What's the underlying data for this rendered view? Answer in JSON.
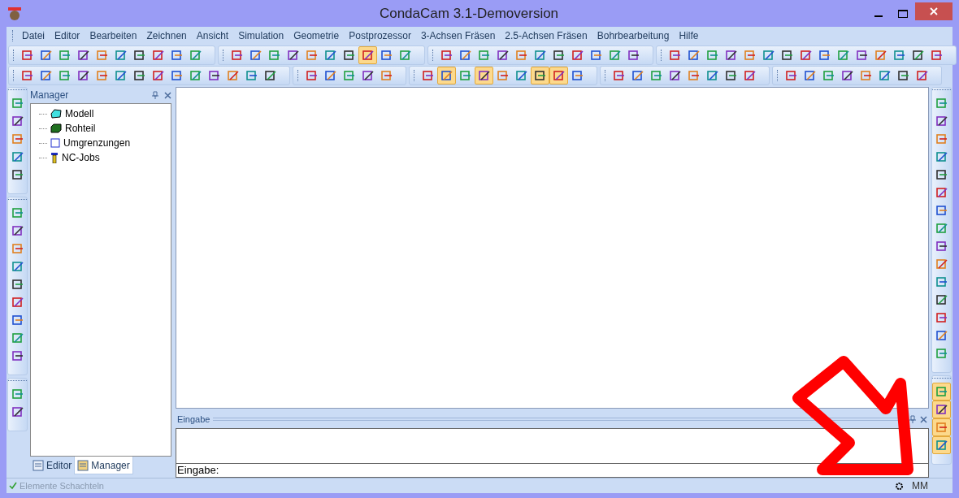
{
  "window": {
    "title": "CondaCam 3.1-Demoversion"
  },
  "menu": [
    "Datei",
    "Editor",
    "Bearbeiten",
    "Zeichnen",
    "Ansicht",
    "Simulation",
    "Geometrie",
    "Postprozessor",
    "3-Achsen Fräsen",
    "2.5-Achsen Fräsen",
    "Bohrbearbeitung",
    "Hilfe"
  ],
  "toolbar_rows": [
    [
      {
        "buttons": [
          {
            "pressed": false
          },
          {
            "pressed": false
          },
          {
            "pressed": false
          },
          {
            "pressed": false
          },
          {
            "pressed": false
          },
          {
            "pressed": false
          },
          {
            "pressed": false
          },
          {
            "pressed": false
          },
          {
            "pressed": false
          },
          {
            "pressed": false
          }
        ]
      },
      {
        "buttons": [
          {
            "pressed": false
          },
          {
            "pressed": false
          },
          {
            "pressed": false
          },
          {
            "pressed": false
          },
          {
            "pressed": false
          },
          {
            "pressed": false
          },
          {
            "pressed": false
          },
          {
            "pressed": true
          },
          {
            "pressed": false
          },
          {
            "pressed": false
          }
        ]
      },
      {
        "buttons": [
          {
            "pressed": false
          },
          {
            "pressed": false
          },
          {
            "pressed": false
          },
          {
            "pressed": false
          },
          {
            "pressed": false
          },
          {
            "pressed": false
          },
          {
            "pressed": false
          },
          {
            "pressed": false
          },
          {
            "pressed": false
          },
          {
            "pressed": false
          },
          {
            "pressed": false
          }
        ]
      },
      {
        "buttons": [
          {
            "pressed": false
          },
          {
            "pressed": false
          },
          {
            "pressed": false
          },
          {
            "pressed": false
          },
          {
            "pressed": false
          },
          {
            "pressed": false
          },
          {
            "pressed": false
          },
          {
            "pressed": false
          },
          {
            "pressed": false
          },
          {
            "pressed": false
          },
          {
            "pressed": false
          },
          {
            "pressed": false
          },
          {
            "pressed": false
          },
          {
            "pressed": false
          },
          {
            "pressed": false
          }
        ]
      }
    ],
    [
      {
        "buttons": [
          {
            "pressed": false
          },
          {
            "pressed": false
          },
          {
            "pressed": false
          },
          {
            "pressed": false
          },
          {
            "pressed": false
          },
          {
            "pressed": false
          },
          {
            "pressed": false
          },
          {
            "pressed": false
          },
          {
            "pressed": false
          },
          {
            "pressed": false
          },
          {
            "pressed": false
          },
          {
            "pressed": false
          },
          {
            "pressed": false
          },
          {
            "pressed": false
          }
        ]
      },
      {
        "buttons": [
          {
            "pressed": false
          },
          {
            "pressed": false
          },
          {
            "pressed": false
          },
          {
            "pressed": false
          },
          {
            "pressed": false
          }
        ]
      },
      {
        "buttons": [
          {
            "pressed": false
          },
          {
            "pressed": true
          },
          {
            "pressed": false
          },
          {
            "pressed": true
          },
          {
            "pressed": false
          },
          {
            "pressed": false
          },
          {
            "pressed": true
          },
          {
            "pressed": true
          },
          {
            "pressed": false
          }
        ]
      },
      {
        "buttons": [
          {
            "pressed": false
          },
          {
            "pressed": false
          },
          {
            "pressed": false
          },
          {
            "pressed": false
          },
          {
            "pressed": false
          },
          {
            "pressed": false
          },
          {
            "pressed": false
          },
          {
            "pressed": false
          }
        ]
      },
      {
        "buttons": [
          {
            "pressed": false
          },
          {
            "pressed": false
          },
          {
            "pressed": false
          },
          {
            "pressed": false
          },
          {
            "pressed": false
          },
          {
            "pressed": false
          },
          {
            "pressed": false
          },
          {
            "pressed": false
          }
        ]
      }
    ]
  ],
  "left_toolbar": [
    {
      "buttons": [
        {
          "pressed": false
        },
        {
          "pressed": false
        },
        {
          "pressed": false
        },
        {
          "pressed": false
        },
        {
          "pressed": false
        }
      ]
    },
    {
      "buttons": [
        {
          "pressed": false
        },
        {
          "pressed": false
        },
        {
          "pressed": false
        },
        {
          "pressed": false
        },
        {
          "pressed": false
        },
        {
          "pressed": false
        },
        {
          "pressed": false
        },
        {
          "pressed": false
        },
        {
          "pressed": false
        }
      ]
    },
    {
      "buttons": [
        {
          "pressed": false
        },
        {
          "pressed": false
        }
      ]
    }
  ],
  "right_toolbar": [
    {
      "buttons": [
        {
          "pressed": false
        },
        {
          "pressed": false
        },
        {
          "pressed": false
        },
        {
          "pressed": false
        },
        {
          "pressed": false
        },
        {
          "pressed": false
        },
        {
          "pressed": false
        },
        {
          "pressed": false
        },
        {
          "pressed": false
        },
        {
          "pressed": false
        },
        {
          "pressed": false
        },
        {
          "pressed": false
        },
        {
          "pressed": false
        },
        {
          "pressed": false
        },
        {
          "pressed": false
        }
      ]
    },
    {
      "buttons": [
        {
          "pressed": true
        },
        {
          "pressed": true
        },
        {
          "pressed": true
        },
        {
          "pressed": true
        }
      ]
    }
  ],
  "manager": {
    "title": "Manager",
    "tree": [
      {
        "label": "Modell"
      },
      {
        "label": "Rohteil"
      },
      {
        "label": "Umgrenzungen"
      },
      {
        "label": "NC-Jobs"
      }
    ],
    "tabs": [
      {
        "label": "Editor",
        "selected": false
      },
      {
        "label": "Manager",
        "selected": true
      }
    ]
  },
  "input_panel": {
    "title": "Eingabe",
    "prompt": "Eingabe:"
  },
  "status_bar": {
    "message": "Elemente Schachteln",
    "message_disabled": true,
    "unit": "MM"
  }
}
